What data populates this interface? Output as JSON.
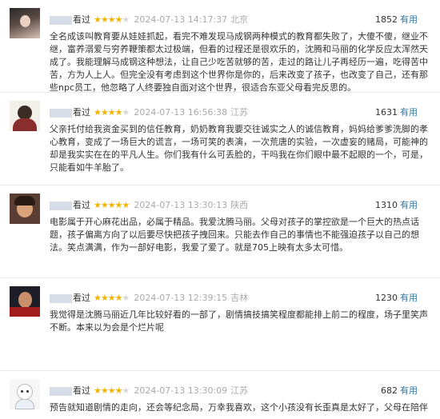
{
  "reviews": [
    {
      "verb": "看过",
      "stars": 4,
      "timestamp": "2024-07-13 14:17:37",
      "location": "北京",
      "votes": "1852",
      "useful_label": "有用",
      "content": "全名成该叫教育要从娃娃抓起，看完不难发现马成钢两种模式的教育都失败了，大傻不傻，继业不继，富养溺爱与穷养鞭策都太过极端，但看的过程还是很欢乐的，沈腾和马丽的化学反应太浑然天成了。我能理解马成钢这种想法，让自己少吃苦就够的苦，走过的路让儿子再经历一遍，吃得苦中苦，方为人上人。但完全没有考虑到这个世界你是你的，后来改变了孩子，也改变了自己，还有那些npc员工，他忽略了人终要独自面对这个世界，很适合东亚父母看完反思的。"
    },
    {
      "verb": "看过",
      "stars": 4,
      "timestamp": "2024-07-13 16:56:38",
      "location": "江苏",
      "votes": "1631",
      "useful_label": "有用",
      "content": "父亲托付给我资金买到的信任教育，奶奶教育我要交往诚实之人的诚信教育，妈妈给爹爹洗脚的孝心教育，变成了一场巨大的谎言，一场可笑的表演，一次荒唐的实验，一次虚妄的赌局，可能神的却是我实实在在的平凡人生。你们我有什么可丢脸的，干吗我在你们眼中最不起眼的一个，可是，只能看如牛羊胎了。"
    },
    {
      "verb": "看过",
      "stars": 5,
      "timestamp": "2024-07-13 13:30:13",
      "location": "陕西",
      "votes": "1310",
      "useful_label": "有用",
      "content": "电影属于开心麻花出品，必属于精品。我爱沈腾马丽。父母对孩子的掌控欲是一个巨大的热点话题，孩子偏离方向了以后要尽快把孩子拽回来。只能去作自己的事情也不能强迫孩子以自己的想法。笑点满满，作为一部好电影，我爱了爱了。就是705上映有太多太可惜。"
    },
    {
      "verb": "看过",
      "stars": 4,
      "timestamp": "2024-07-13 12:39:15",
      "location": "吉林",
      "votes": "1230",
      "useful_label": "有用",
      "content": "我觉得是沈腾马丽近几年比较好看的一部了，剧情搞技搞笑程度都能排上前二的程度，场子里笑声不断。本来以为会是个烂片呢"
    },
    {
      "verb": "看过",
      "stars": 4,
      "timestamp": "2024-07-13 13:30:09",
      "location": "江苏",
      "votes": "682",
      "useful_label": "有用",
      "content": "预告就知道剧情的走向，还会等纪念局，万幸我喜欢，这个小孩没有长歪真是太好了，父母在陪伴在理解，真好"
    }
  ]
}
